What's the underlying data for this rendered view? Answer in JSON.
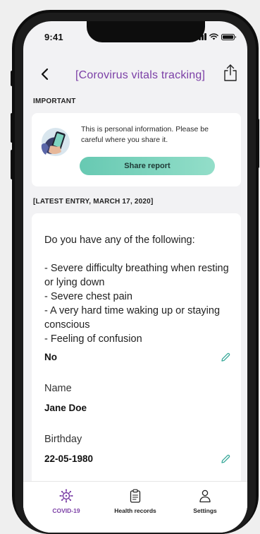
{
  "status_bar": {
    "time": "9:41"
  },
  "header": {
    "title": "[Corovirus vitals tracking]",
    "back_icon": "chevron-left-icon",
    "share_icon": "share-upload-icon"
  },
  "important": {
    "section_label": "IMPORTANT",
    "message": "This is personal information. Please be careful where you share it.",
    "share_button_label": "Share report"
  },
  "latest_entry": {
    "section_label": "[LATEST ENTRY, MARCH 17, 2020]",
    "question": "Do you have any of the following:\n\n- Severe difficulty breathing when resting or lying down\n- Severe chest pain\n- A very hard time waking up or staying conscious\n- Feeling of confusion",
    "answer": "No",
    "name_label": "Name",
    "name_value": "Jane Doe",
    "birthday_label": "Birthday",
    "birthday_value": "22-05-1980"
  },
  "tab_bar": {
    "tabs": [
      {
        "label": "COVID-19",
        "icon": "virus-icon",
        "active": true
      },
      {
        "label": "Health records",
        "icon": "clipboard-icon",
        "active": false
      },
      {
        "label": "Settings",
        "icon": "user-icon",
        "active": false
      }
    ]
  },
  "colors": {
    "accent": "#7b3fa6",
    "button_gradient_start": "#67c9b2",
    "button_gradient_end": "#93dec9",
    "edit_icon": "#3aa99a"
  }
}
